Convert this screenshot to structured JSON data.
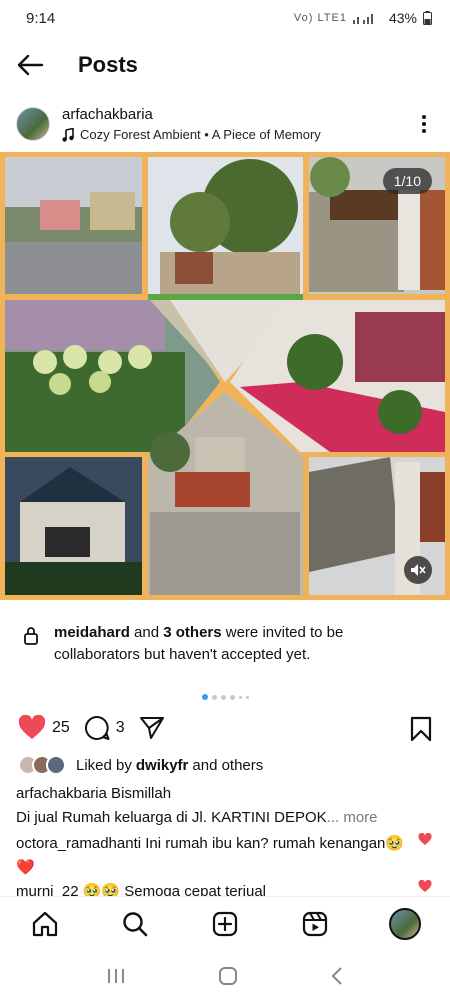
{
  "status": {
    "time": "9:14",
    "network": "Vo) LTE1",
    "battery": "43%"
  },
  "header": {
    "title": "Posts"
  },
  "post": {
    "username": "arfachakbaria",
    "music": "Cozy Forest Ambient • A Piece of Memory",
    "counter": "1/10"
  },
  "collab": {
    "user": "meidahard",
    "and_text": " and ",
    "others": "3 others",
    "rest": " were invited to be collaborators but haven't accepted yet."
  },
  "actions": {
    "likes": "25",
    "comments": "3"
  },
  "liked_by": {
    "prefix": "Liked by ",
    "user": "dwikyfr",
    "suffix": " and others"
  },
  "caption": {
    "user": "arfachakbaria",
    "text": " Bismillah",
    "line2": "Di jual Rumah keluarga di Jl. KARTINI DEPOK",
    "more": "... more"
  },
  "comments": [
    {
      "user": "octora_ramadhanti",
      "text": " Ini rumah ibu kan? rumah kenangan🥹❤️"
    },
    {
      "user": "murni_22",
      "text": " 🥹🥹 Semoga cepat terjual"
    }
  ],
  "colors": {
    "accent": "#3897f0",
    "like": "#ed4956",
    "frame": "#f0b35a"
  },
  "icons": [
    "back-arrow-icon",
    "music-note-icon",
    "more-vert-icon",
    "lock-icon",
    "heart-icon",
    "comment-icon",
    "share-icon",
    "bookmark-icon",
    "home-icon",
    "search-icon",
    "add-icon",
    "reels-icon",
    "mute-icon"
  ]
}
